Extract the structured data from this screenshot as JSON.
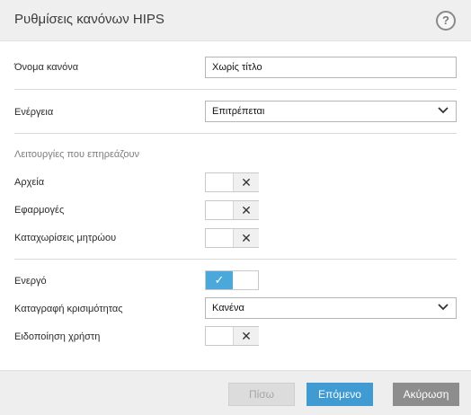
{
  "dialog": {
    "title": "Ρυθμίσεις κανόνων HIPS",
    "help_glyph": "?"
  },
  "form": {
    "rule_name": {
      "label": "Όνομα κανόνα",
      "value": "Χωρίς τίτλο"
    },
    "action": {
      "label": "Ενέργεια",
      "value": "Επιτρέπεται"
    },
    "affected_section": "Λειτουργίες που επηρεάζουν",
    "files": {
      "label": "Αρχεία",
      "state": "off",
      "glyph": "✕"
    },
    "applications": {
      "label": "Εφαρμογές",
      "state": "off",
      "glyph": "✕"
    },
    "registry": {
      "label": "Καταχωρίσεις μητρώου",
      "state": "off",
      "glyph": "✕"
    },
    "enabled": {
      "label": "Ενεργό",
      "state": "on",
      "glyph": "✓"
    },
    "severity_logging": {
      "label": "Καταγραφή κρισιμότητας",
      "value": "Κανένα"
    },
    "notify_user": {
      "label": "Ειδοποίηση χρήστη",
      "state": "off",
      "glyph": "✕"
    }
  },
  "footer": {
    "back": "Πίσω",
    "next": "Επόμενο",
    "cancel": "Ακύρωση"
  },
  "colors": {
    "accent": "#4aa9da",
    "primary_button": "#3f9bd1",
    "cancel_button": "#8d8d8d"
  }
}
